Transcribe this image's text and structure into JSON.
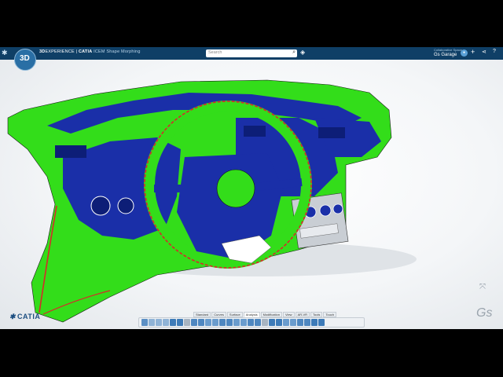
{
  "header": {
    "brand_prefix": "3D",
    "brand_suffix": "EXPERIENCE",
    "app_name": "CATIA",
    "app_subtitle": "ICEM Shape Morphing",
    "search_placeholder": "Search",
    "context_label": "Gs Garage",
    "context_small": "Collaborative Space"
  },
  "compass_label": "3D",
  "bottom": {
    "catia_logo": "CATIA",
    "watermark": "Gs"
  },
  "action_bar": {
    "tabs": [
      "Standard",
      "Curves",
      "Surface",
      "Analysis",
      "Modification",
      "View",
      "AR-VR",
      "Tools",
      "Touch"
    ],
    "active_tab": "Analysis"
  },
  "colors": {
    "header": "#0f3f66",
    "surface_green": "#33dd1a",
    "surface_blue": "#1a2fa8",
    "curve_red": "#d72a2a",
    "background": "#f4f6f8"
  },
  "icons": [
    "search-icon",
    "tag-icon",
    "avatar-icon",
    "plus-icon",
    "share-icon",
    "help-icon",
    "compass-icon",
    "ds-logo-icon"
  ]
}
